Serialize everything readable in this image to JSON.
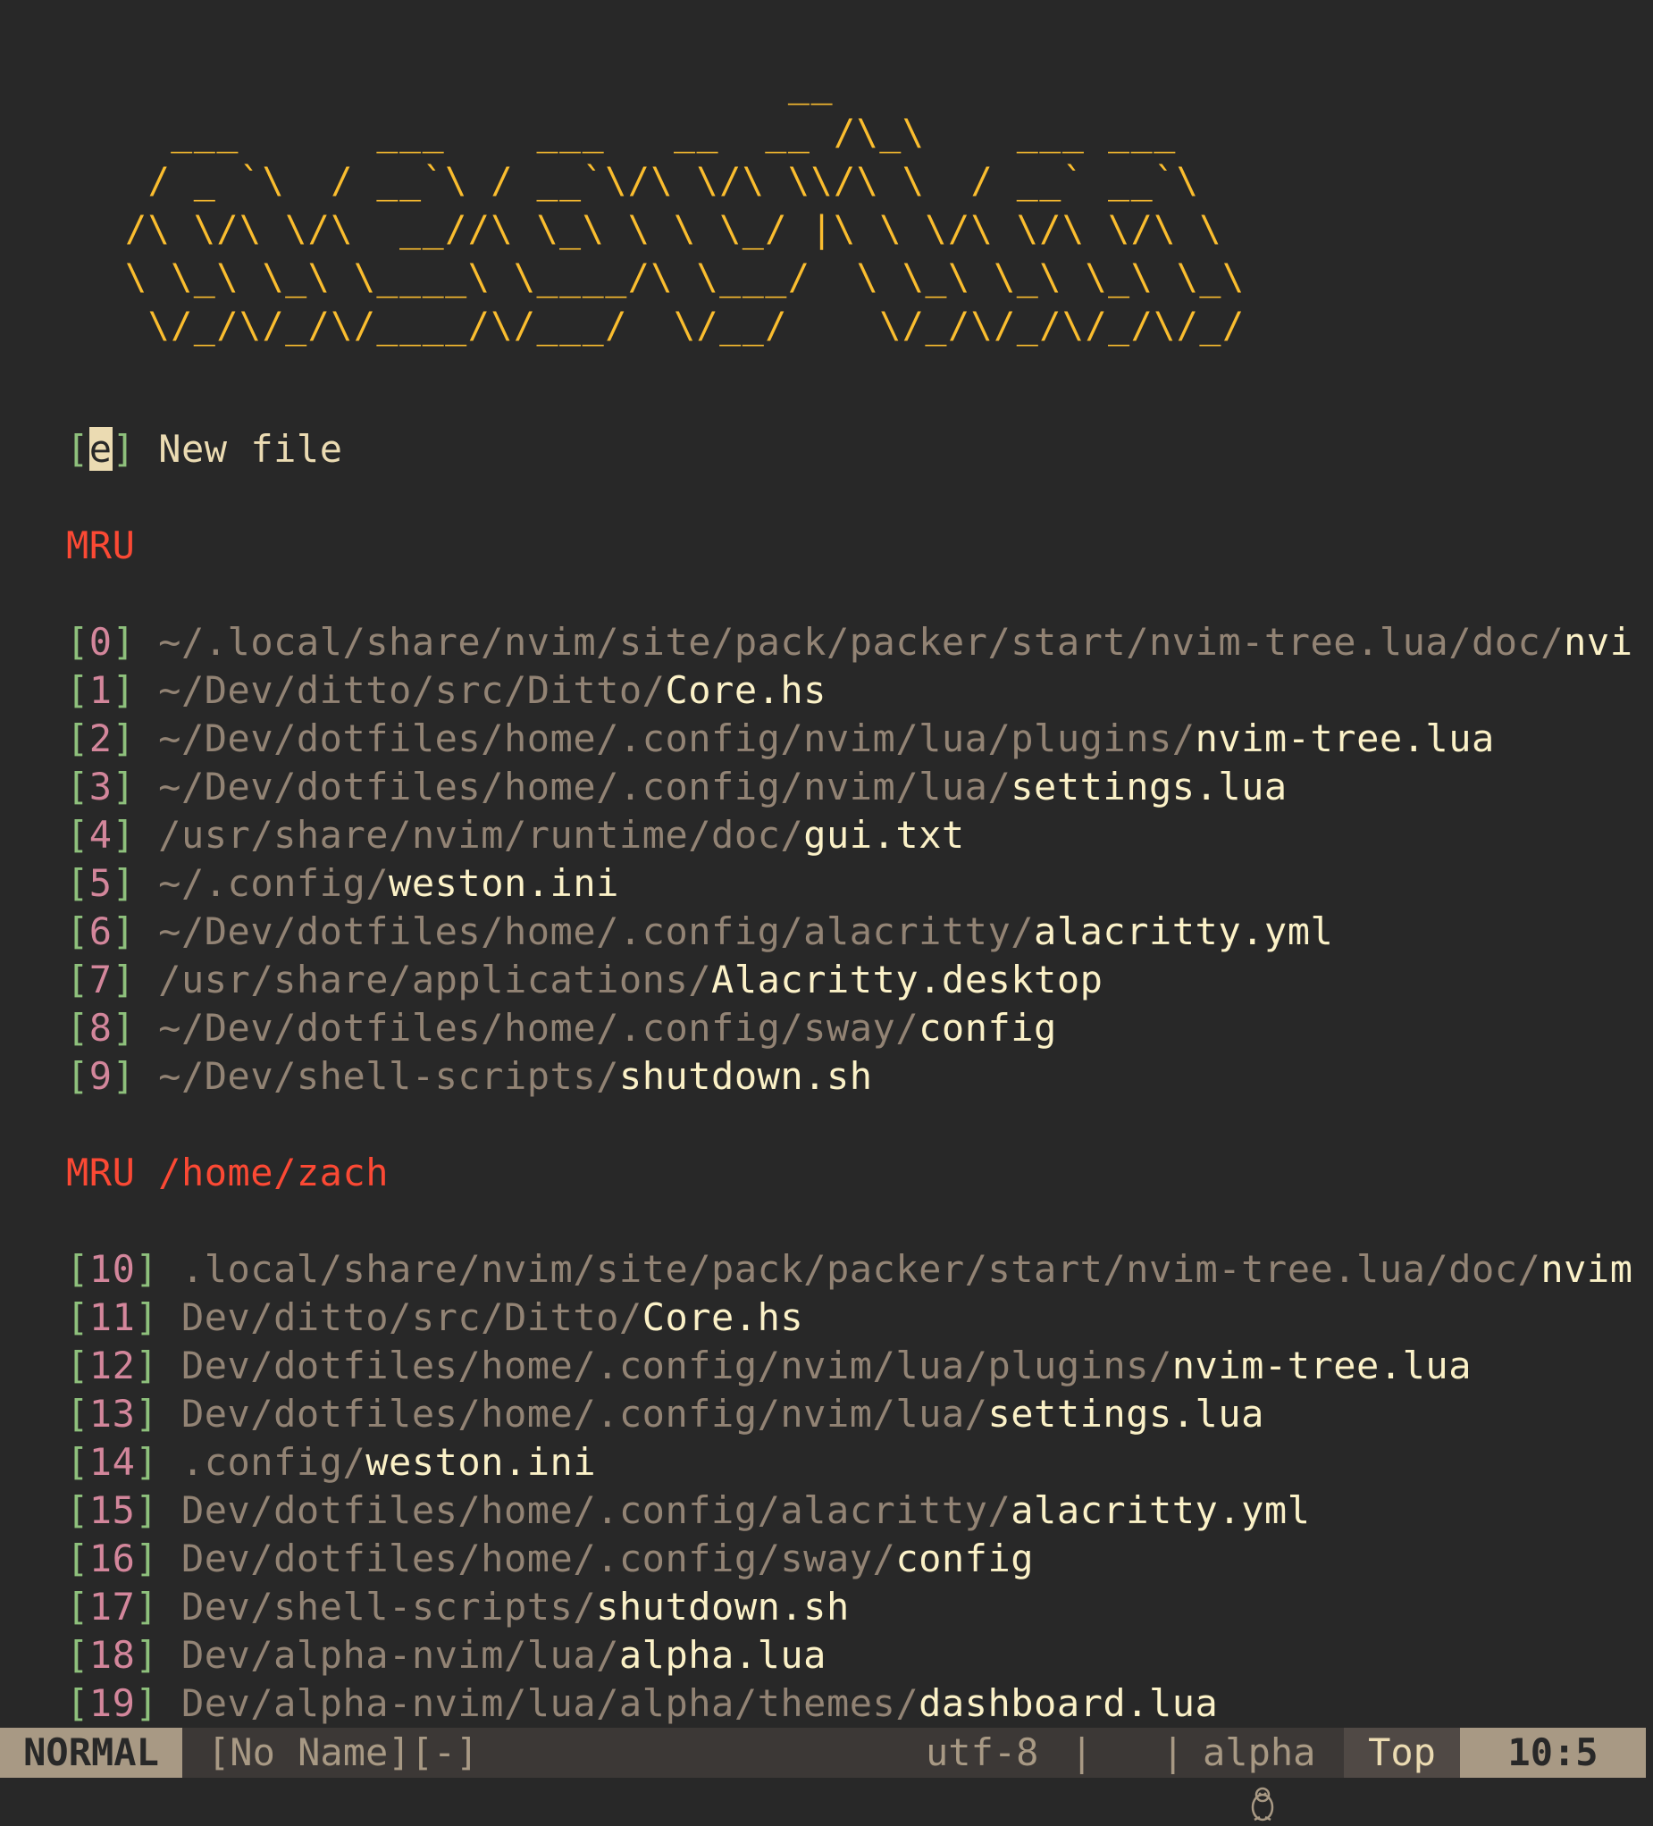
{
  "banner": {
    "lines": [
      "                             __",
      "  ___      ___    ___   __  __ /\\_\\    ___ ___",
      " / _ `\\  / __`\\ / __`\\/\\ \\/\\ \\\\/\\ \\  / __` __`\\",
      "/\\ \\/\\ \\/\\  __//\\ \\_\\ \\ \\ \\_/ |\\ \\ \\/\\ \\/\\ \\/\\ \\",
      "\\ \\_\\ \\_\\ \\____\\ \\____/\\ \\___/  \\ \\_\\ \\_\\ \\_\\ \\_\\",
      " \\/_/\\/_/\\/____/\\/___/  \\/__/    \\/_/\\/_/\\/_/\\/_/"
    ]
  },
  "new_file": {
    "key": "e",
    "label": "New file"
  },
  "mru_header": "MRU",
  "mru_items": [
    {
      "key": "0",
      "dir": "~/.local/share/nvim/site/pack/packer/start/nvim-tree.lua/doc/",
      "file": "nvi"
    },
    {
      "key": "1",
      "dir": "~/Dev/ditto/src/Ditto/",
      "file": "Core.hs"
    },
    {
      "key": "2",
      "dir": "~/Dev/dotfiles/home/.config/nvim/lua/plugins/",
      "file": "nvim-tree.lua"
    },
    {
      "key": "3",
      "dir": "~/Dev/dotfiles/home/.config/nvim/lua/",
      "file": "settings.lua"
    },
    {
      "key": "4",
      "dir": "/usr/share/nvim/runtime/doc/",
      "file": "gui.txt"
    },
    {
      "key": "5",
      "dir": "~/.config/",
      "file": "weston.ini"
    },
    {
      "key": "6",
      "dir": "~/Dev/dotfiles/home/.config/alacritty/",
      "file": "alacritty.yml"
    },
    {
      "key": "7",
      "dir": "/usr/share/applications/",
      "file": "Alacritty.desktop"
    },
    {
      "key": "8",
      "dir": "~/Dev/dotfiles/home/.config/sway/",
      "file": "config"
    },
    {
      "key": "9",
      "dir": "~/Dev/shell-scripts/",
      "file": "shutdown.sh"
    }
  ],
  "mru_cwd_header": {
    "label": "MRU",
    "path": "/home/zach"
  },
  "mru_cwd_items": [
    {
      "key": "10",
      "dir": ".local/share/nvim/site/pack/packer/start/nvim-tree.lua/doc/",
      "file": "nvim"
    },
    {
      "key": "11",
      "dir": "Dev/ditto/src/Ditto/",
      "file": "Core.hs"
    },
    {
      "key": "12",
      "dir": "Dev/dotfiles/home/.config/nvim/lua/plugins/",
      "file": "nvim-tree.lua"
    },
    {
      "key": "13",
      "dir": "Dev/dotfiles/home/.config/nvim/lua/",
      "file": "settings.lua"
    },
    {
      "key": "14",
      "dir": ".config/",
      "file": "weston.ini"
    },
    {
      "key": "15",
      "dir": "Dev/dotfiles/home/.config/alacritty/",
      "file": "alacritty.yml"
    },
    {
      "key": "16",
      "dir": "Dev/dotfiles/home/.config/sway/",
      "file": "config"
    },
    {
      "key": "17",
      "dir": "Dev/shell-scripts/",
      "file": "shutdown.sh"
    },
    {
      "key": "18",
      "dir": "Dev/alpha-nvim/lua/",
      "file": "alpha.lua"
    },
    {
      "key": "19",
      "dir": "Dev/alpha-nvim/lua/alpha/themes/",
      "file": "dashboard.lua"
    }
  ],
  "statusline": {
    "mode": "NORMAL",
    "buffer": "[No Name][-]",
    "encoding": "utf-8",
    "separator": "|",
    "os_icon": "linux-penguin-icon",
    "filetype": "alpha",
    "position": "Top",
    "line_col": "10:5"
  },
  "colors": {
    "background": "#282828",
    "banner": "#fabd2f",
    "bracket": "#8ec07c",
    "key": "#d3869b",
    "path": "#928374",
    "file": "#fbf1c7",
    "header": "#fb4934"
  }
}
